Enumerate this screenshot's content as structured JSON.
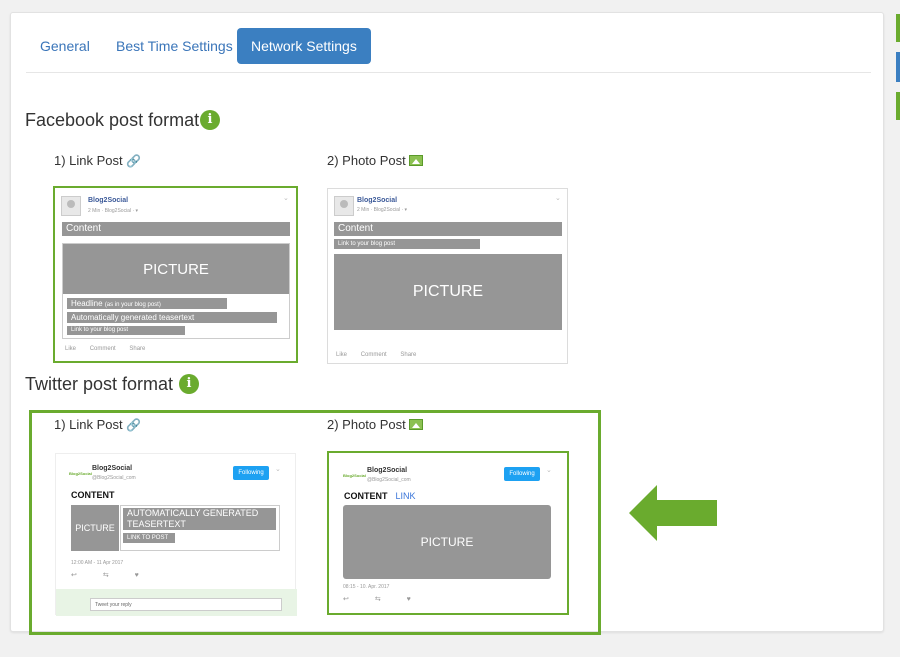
{
  "tabs": [
    {
      "label": "General",
      "active": false
    },
    {
      "label": "Best Time Settings",
      "active": false
    },
    {
      "label": "Network Settings",
      "active": true
    }
  ],
  "facebook": {
    "title": "Facebook post format",
    "link_post": {
      "label": "1) Link Post",
      "preview": {
        "name": "Blog2Social",
        "meta": "2 Min · Blog2Social · ",
        "content": "Content",
        "picture": "PICTURE",
        "headline": "Headline",
        "headline_note": "(as in your blog post)",
        "teaser": "Automatically generated teasertext",
        "link": "Link to your blog post",
        "actions": [
          "Like",
          "Comment",
          "Share"
        ]
      }
    },
    "photo_post": {
      "label": "2) Photo Post",
      "preview": {
        "name": "Blog2Social",
        "meta": "2 Min · Blog2Social · ",
        "content": "Content",
        "link": "Link to your blog post",
        "picture": "PICTURE",
        "actions": [
          "Like",
          "Comment",
          "Share"
        ]
      }
    }
  },
  "twitter": {
    "title": "Twitter post format",
    "link_post": {
      "label": "1) Link Post",
      "preview": {
        "logo": "Blog2Social",
        "name": "Blog2Social",
        "handle": "@Blog2Social_com",
        "follow": "Following",
        "content": "CONTENT",
        "picture": "PICTURE",
        "teaser": "AUTOMATICALLY GENERATED TEASERTEXT",
        "link": "LINK TO POST",
        "time": "12:00 AM - 11 Apr 2017",
        "reply_placeholder": "Tweet your reply"
      }
    },
    "photo_post": {
      "label": "2) Photo Post",
      "preview": {
        "logo": "Blog2Social",
        "name": "Blog2Social",
        "handle": "@Blog2Social_com",
        "follow": "Following",
        "content": "CONTENT",
        "link": "LINK",
        "picture": "PICTURE",
        "time": "08:15 - 10. Apr. 2017"
      }
    }
  },
  "colors": {
    "accent_green": "#6aab2e",
    "tab_blue": "#3b7fc1",
    "placeholder_gray": "#969696",
    "twitter_blue": "#1da1f2"
  },
  "icons": [
    "info-icon",
    "link-icon",
    "photo-icon",
    "left-arrow-icon"
  ]
}
